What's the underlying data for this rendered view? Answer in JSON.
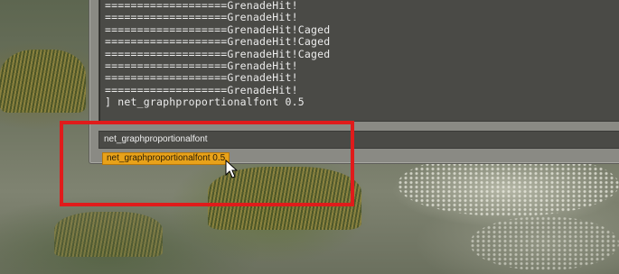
{
  "console": {
    "log_lines": [
      "===================GrenadeHit!",
      "===================GrenadeHit!",
      "===================GrenadeHit!Caged",
      "===================GrenadeHit!Caged",
      "===================GrenadeHit!Caged",
      "===================GrenadeHit!",
      "===================GrenadeHit!",
      "===================GrenadeHit!",
      "] net_graphproportionalfont 0.5"
    ],
    "input_value": "net_graphproportionalfont",
    "suggestion": "net_graphproportionalfont 0.5"
  },
  "colors": {
    "highlight": "#e01b1b",
    "suggestion_bg": "#e8a21a"
  }
}
